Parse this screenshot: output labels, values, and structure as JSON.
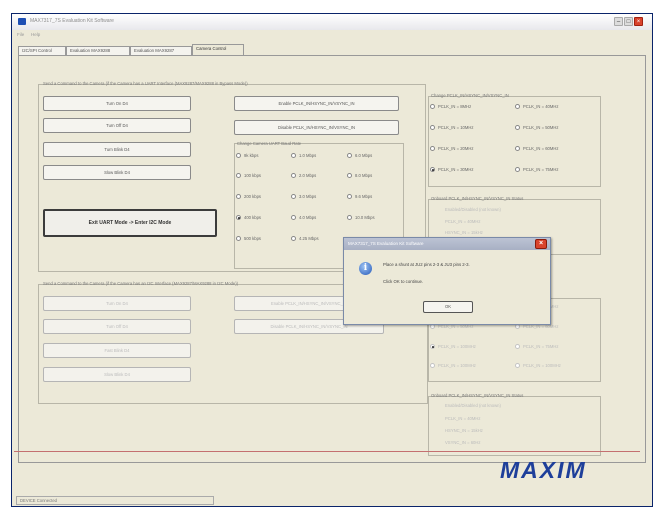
{
  "window": {
    "title": "MAX7317_7S Evaluation Kit Software",
    "menu": [
      "File",
      "Help"
    ],
    "tabs": [
      "I2C/SPI Control",
      "Evaluation MAX9288",
      "Evaluation MAX9287",
      "Camera Control"
    ],
    "active_tab_index": 3
  },
  "uart_section": {
    "caption": "Send a Command to the Camera (if the Camera has a UART Interface (MAX9287/MAX9288 in Bypass Mode))",
    "buttons_left": [
      "Turn On D4",
      "Turn Off D4",
      "Turn Blink D4",
      "Slow Blink D4"
    ],
    "big_button": "Exit UART Mode -> Enter I2C Mode",
    "buttons_mid": [
      "Enable PCLK_IN/HSYNC_IN/VSYNC_IN",
      "Disable PCLK_IN/HSYNC_IN/VSYNC_IN"
    ],
    "baud": {
      "caption": "Change Camera UART Baud Rate",
      "options": [
        "9k kbps",
        "1.0 Mbps",
        "6.0 Mbps",
        "100 kbps",
        "2.0 Mbps",
        "8.0 Mbps",
        "200 kbps",
        "3.0 Mbps",
        "9.6 Mbps",
        "400 kbps",
        "4.0 Mbps",
        "10.0 Mbps",
        "500 kbps",
        "4.25 Mbps"
      ],
      "selected_index": 9
    }
  },
  "pclk_group": {
    "caption": "Change PCLK_IN/HSYNC_IN/VSYNC_IN",
    "options": [
      "PCLK_IN = 8MHz",
      "PCLK_IN = 40MHz",
      "PCLK_IN = 10MHz",
      "PCLK_IN = 50MHz",
      "PCLK_IN = 20MHz",
      "PCLK_IN = 60MHz",
      "PCLK_IN = 30MHz",
      "PCLK_IN = 75MHz"
    ],
    "selected_index": 6
  },
  "status_group": {
    "caption": "Onboard PCLK_IN/HSYNC_IN/VSYNC_IN Status",
    "lines": [
      "Enabled/Disabled (not known)",
      "PCLK_IN = 40MHz",
      "HSYNC_IN = 15kHz",
      "VSYNC_IN = 60Hz"
    ]
  },
  "i2c_section": {
    "caption": "Send a Command to the Camera (if the Camera has an I2C Interface (MAX9287/MAX9288 in I2C Mode))",
    "buttons_left": [
      "Turn On D4",
      "Turn Off D4",
      "Fast Blink D4",
      "Slow Blink D4"
    ],
    "buttons_mid": [
      "Enable PCLK_IN/HSYNC_IN/VSYNC_IN",
      "Disable PCLK_IN/HSYNC_IN/VSYNC_IN"
    ],
    "pclk_caption": "Change PCLK_IN/HSYNC_IN/VSYNC_IN",
    "pclk_options": [
      "PCLK_IN = 30MHz",
      "PCLK_IN = 40MHz",
      "PCLK_IN = 50MHz",
      "PCLK_IN = 60MHz",
      "PCLK_IN = 100MHz",
      "PCLK_IN = 75MHz",
      "PCLK_IN = 100MHz",
      "PCLK_IN = 100MHz"
    ],
    "status_caption": "Onboard PCLK_IN/HSYNC_IN/VSYNC_IN Status",
    "status_lines": [
      "Enabled/Disabled (not known)",
      "PCLK_IN = 40MHz",
      "HSYNC_IN = 15kHz",
      "VSYNC_IN = 60Hz"
    ]
  },
  "dialog": {
    "title": "MAX7317_7S Evaluation Kit Software",
    "message_lines": [
      "Place a shunt at JU2 pins 2-3 & JU3 pins 2-3.",
      "Click OK to continue."
    ],
    "ok_label": "OK"
  },
  "logo_text": "MAXIM",
  "status_bar": {
    "text": "DEVICE Connected"
  }
}
